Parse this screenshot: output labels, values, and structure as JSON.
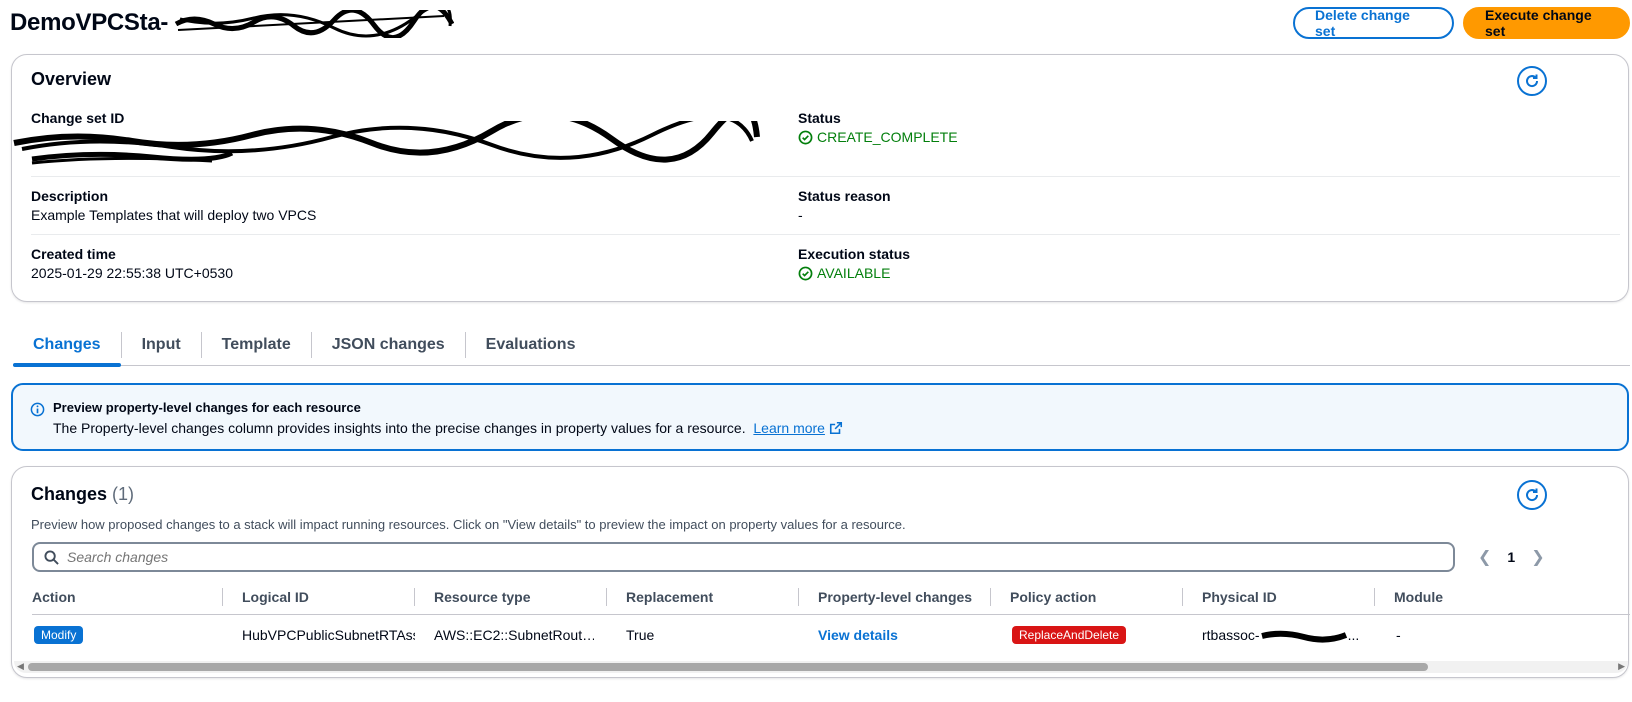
{
  "header": {
    "title": "DemoVPCSta-",
    "delete_label": "Delete change set",
    "execute_label": "Execute change set"
  },
  "overview": {
    "title": "Overview",
    "change_set_id_label": "Change set ID",
    "status_label": "Status",
    "status_value": "CREATE_COMPLETE",
    "description_label": "Description",
    "description_value": "Example Templates that will deploy two VPCS",
    "status_reason_label": "Status reason",
    "status_reason_value": "-",
    "created_time_label": "Created time",
    "created_time_value": "2025-01-29 22:55:38 UTC+0530",
    "execution_status_label": "Execution status",
    "execution_status_value": "AVAILABLE"
  },
  "tabs": [
    {
      "label": "Changes",
      "active": true
    },
    {
      "label": "Input"
    },
    {
      "label": "Template"
    },
    {
      "label": "JSON changes"
    },
    {
      "label": "Evaluations"
    }
  ],
  "alert": {
    "title": "Preview property-level changes for each resource",
    "body": "The Property-level changes column provides insights into the precise changes in property values for a resource.",
    "link": "Learn more"
  },
  "changes": {
    "title": "Changes",
    "count": "(1)",
    "description": "Preview how proposed changes to a stack will impact running resources. Click on \"View details\" to preview the impact on property values for a resource.",
    "search_placeholder": "Search changes",
    "page": "1",
    "columns": [
      "Action",
      "Logical ID",
      "Resource type",
      "Replacement",
      "Property-level changes",
      "Policy action",
      "Physical ID",
      "Module"
    ],
    "row": {
      "action": "Modify",
      "logical_id": "HubVPCPublicSubnetRTAssc",
      "resource_type": "AWS::EC2::SubnetRout…",
      "replacement": "True",
      "property_changes": "View details",
      "policy_action": "ReplaceAndDelete",
      "physical_id": "rtbassoc-",
      "physical_id_suffix": "...",
      "module": "-"
    }
  },
  "colors": {
    "accent": "#0972d3",
    "primary_button": "#ff9900",
    "success": "#037f0c",
    "danger_badge": "#d91515",
    "info_bg": "#f2f8fd"
  }
}
